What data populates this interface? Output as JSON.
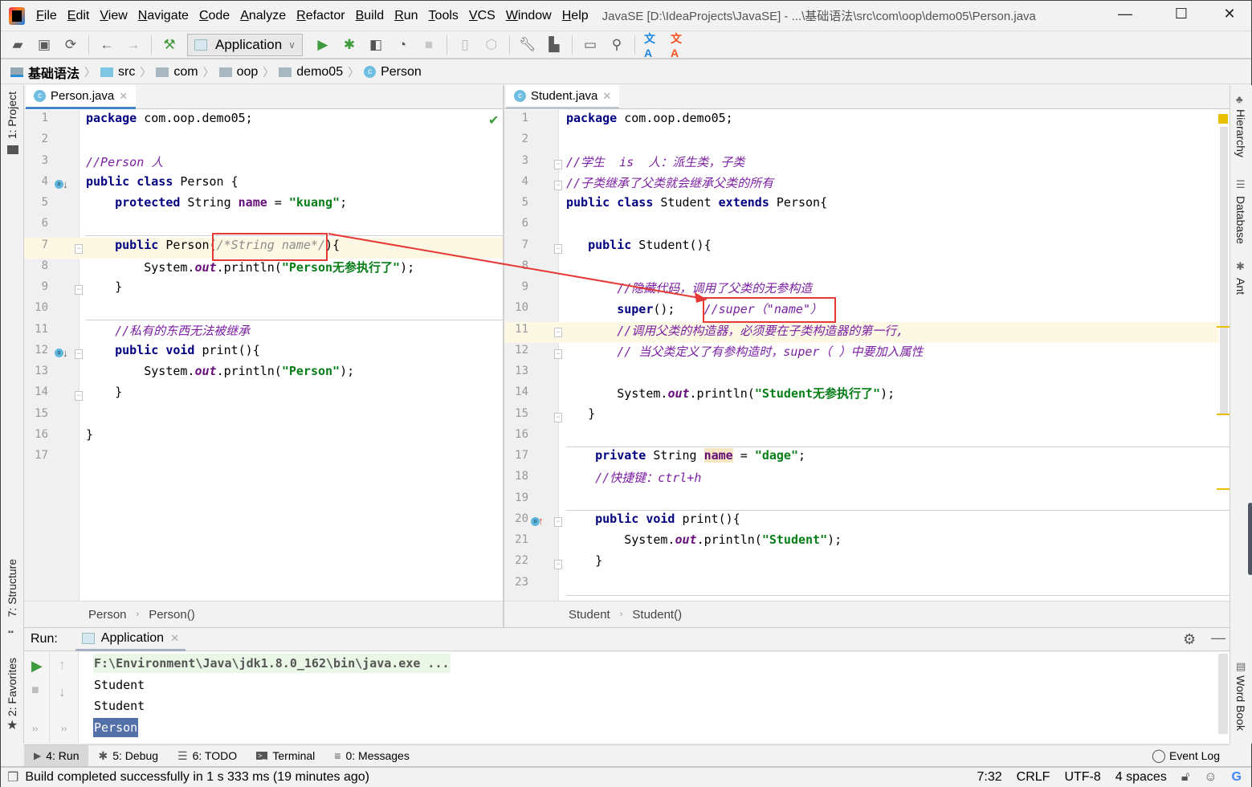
{
  "window": {
    "title": "JavaSE [D:\\IdeaProjects\\JavaSE] - ...\\基础语法\\src\\com\\oop\\demo05\\Person.java",
    "controls": {
      "minimize": "—",
      "maximize": "☐",
      "close": "✕"
    }
  },
  "menu": [
    "File",
    "Edit",
    "View",
    "Navigate",
    "Code",
    "Analyze",
    "Refactor",
    "Build",
    "Run",
    "Tools",
    "VCS",
    "Window",
    "Help"
  ],
  "toolbar": {
    "run_config": "Application",
    "icons": [
      "open-folder",
      "save-all",
      "synchronize",
      "back",
      "forward",
      "build-hammer",
      "run",
      "debug",
      "run-with-coverage",
      "profile",
      "stop",
      "attach-device",
      "sdk-manager",
      "settings-wrench",
      "project-structure",
      "terminal",
      "search",
      "translate",
      "translate-alt"
    ]
  },
  "navbar": {
    "crumbs": [
      "基础语法",
      "src",
      "com",
      "oop",
      "demo05",
      "Person"
    ]
  },
  "left_stripe": {
    "project": "1: Project",
    "structure": "7: Structure",
    "favorites": "2: Favorites"
  },
  "right_stripe": {
    "hierarchy": "Hierarchy",
    "database": "Database",
    "ant": "Ant",
    "wordbook": "Word Book"
  },
  "left_editor": {
    "tab": "Person.java",
    "breadcrumb": [
      "Person",
      "Person()"
    ],
    "lines": [
      {
        "n": "1",
        "html": "<span class='kw'>package</span> com.oop.demo05;"
      },
      {
        "n": "2",
        "html": ""
      },
      {
        "n": "3",
        "html": "<span class='cmt'>//Person 人</span>"
      },
      {
        "n": "4",
        "html": "<span class='kw'>public class</span> Person {"
      },
      {
        "n": "5",
        "html": "    <span class='kw'>protected</span> String <span class='fld'>name</span> = <span class='str'>\"kuang\"</span>;"
      },
      {
        "n": "6",
        "html": ""
      },
      {
        "n": "7",
        "html": "    <span class='kw'>public</span> Person(<span class='cm'>/*String name*/</span>){"
      },
      {
        "n": "8",
        "html": "        System.<span class='stat'>out</span>.println(<span class='str'>\"Person无参执行了\"</span>);"
      },
      {
        "n": "9",
        "html": "    }"
      },
      {
        "n": "10",
        "html": ""
      },
      {
        "n": "11",
        "html": "    <span class='cmt'>//私有的东西无法被继承</span>"
      },
      {
        "n": "12",
        "html": "    <span class='kw'>public void</span> print(){"
      },
      {
        "n": "13",
        "html": "        System.<span class='stat'>out</span>.println(<span class='str'>\"Person\"</span>);"
      },
      {
        "n": "14",
        "html": "    }"
      },
      {
        "n": "15",
        "html": ""
      },
      {
        "n": "16",
        "html": "}"
      },
      {
        "n": "17",
        "html": ""
      }
    ]
  },
  "right_editor": {
    "tab": "Student.java",
    "breadcrumb": [
      "Student",
      "Student()"
    ],
    "lines": [
      {
        "n": "1",
        "html": "<span class='kw'>package</span> com.oop.demo05;"
      },
      {
        "n": "2",
        "html": ""
      },
      {
        "n": "3",
        "html": "<span class='cmt'>//学生  is  人：派生类，子类</span>"
      },
      {
        "n": "4",
        "html": "<span class='cmt'>//子类继承了父类就会继承父类的所有</span>"
      },
      {
        "n": "5",
        "html": "<span class='kw'>public class</span> Student <span class='kw'>extends</span> Person{"
      },
      {
        "n": "6",
        "html": ""
      },
      {
        "n": "7",
        "html": "   <span class='kw'>public</span> Student(){"
      },
      {
        "n": "8",
        "html": ""
      },
      {
        "n": "9",
        "html": "       <span class='cmt'>//隐藏代码，调用了父类的无参构造</span>"
      },
      {
        "n": "10",
        "html": "       <span class='kw'>super</span>();    <span class='cmt'>//super（\"name\"）</span>"
      },
      {
        "n": "11",
        "html": "       <span class='cmt'>//调用父类的构造器，必须要在子类构造器的第一行,</span>"
      },
      {
        "n": "12",
        "html": "       <span class='cmt'>// 当父类定义了有参构造时，super（ ）中要加入属性</span>"
      },
      {
        "n": "13",
        "html": ""
      },
      {
        "n": "14",
        "html": "       System.<span class='stat'>out</span>.println(<span class='str'>\"Student无参执行了\"</span>);"
      },
      {
        "n": "15",
        "html": "   }"
      },
      {
        "n": "16",
        "html": ""
      },
      {
        "n": "17",
        "html": "    <span class='kw'>private</span> String <span class='fld' style='background:#f5e7c4'>name</span> = <span class='str'>\"dage\"</span>;"
      },
      {
        "n": "18",
        "html": "    <span class='cmt'>//快捷键：ctrl+h</span>"
      },
      {
        "n": "19",
        "html": ""
      },
      {
        "n": "20",
        "html": "    <span class='kw'>public void</span> print(){"
      },
      {
        "n": "21",
        "html": "        System.<span class='stat'>out</span>.println(<span class='str'>\"Student\"</span>);"
      },
      {
        "n": "22",
        "html": "    }"
      },
      {
        "n": "23",
        "html": ""
      }
    ]
  },
  "run_panel": {
    "label": "Run:",
    "tab": "Application",
    "console": [
      {
        "text": "F:\\Environment\\Java\\jdk1.8.0_162\\bin\\java.exe ...",
        "style": "cmd"
      },
      {
        "text": "Student",
        "style": "out"
      },
      {
        "text": "Student",
        "style": "out"
      },
      {
        "text": "Person",
        "style": "selected"
      }
    ]
  },
  "bottom_tabs": [
    "4: Run",
    "5: Debug",
    "6: TODO",
    "Terminal",
    "0: Messages"
  ],
  "event_log": "Event Log",
  "status": {
    "message": "Build completed successfully in 1 s 333 ms (19 minutes ago)",
    "position": "7:32",
    "line_sep": "CRLF",
    "encoding": "UTF-8",
    "indent": "4 spaces"
  },
  "colors": {
    "accent_tab": "#4083c9",
    "annotation_red": "#e53935",
    "run_green": "#3d9b3d",
    "selection": "#5470a8"
  }
}
